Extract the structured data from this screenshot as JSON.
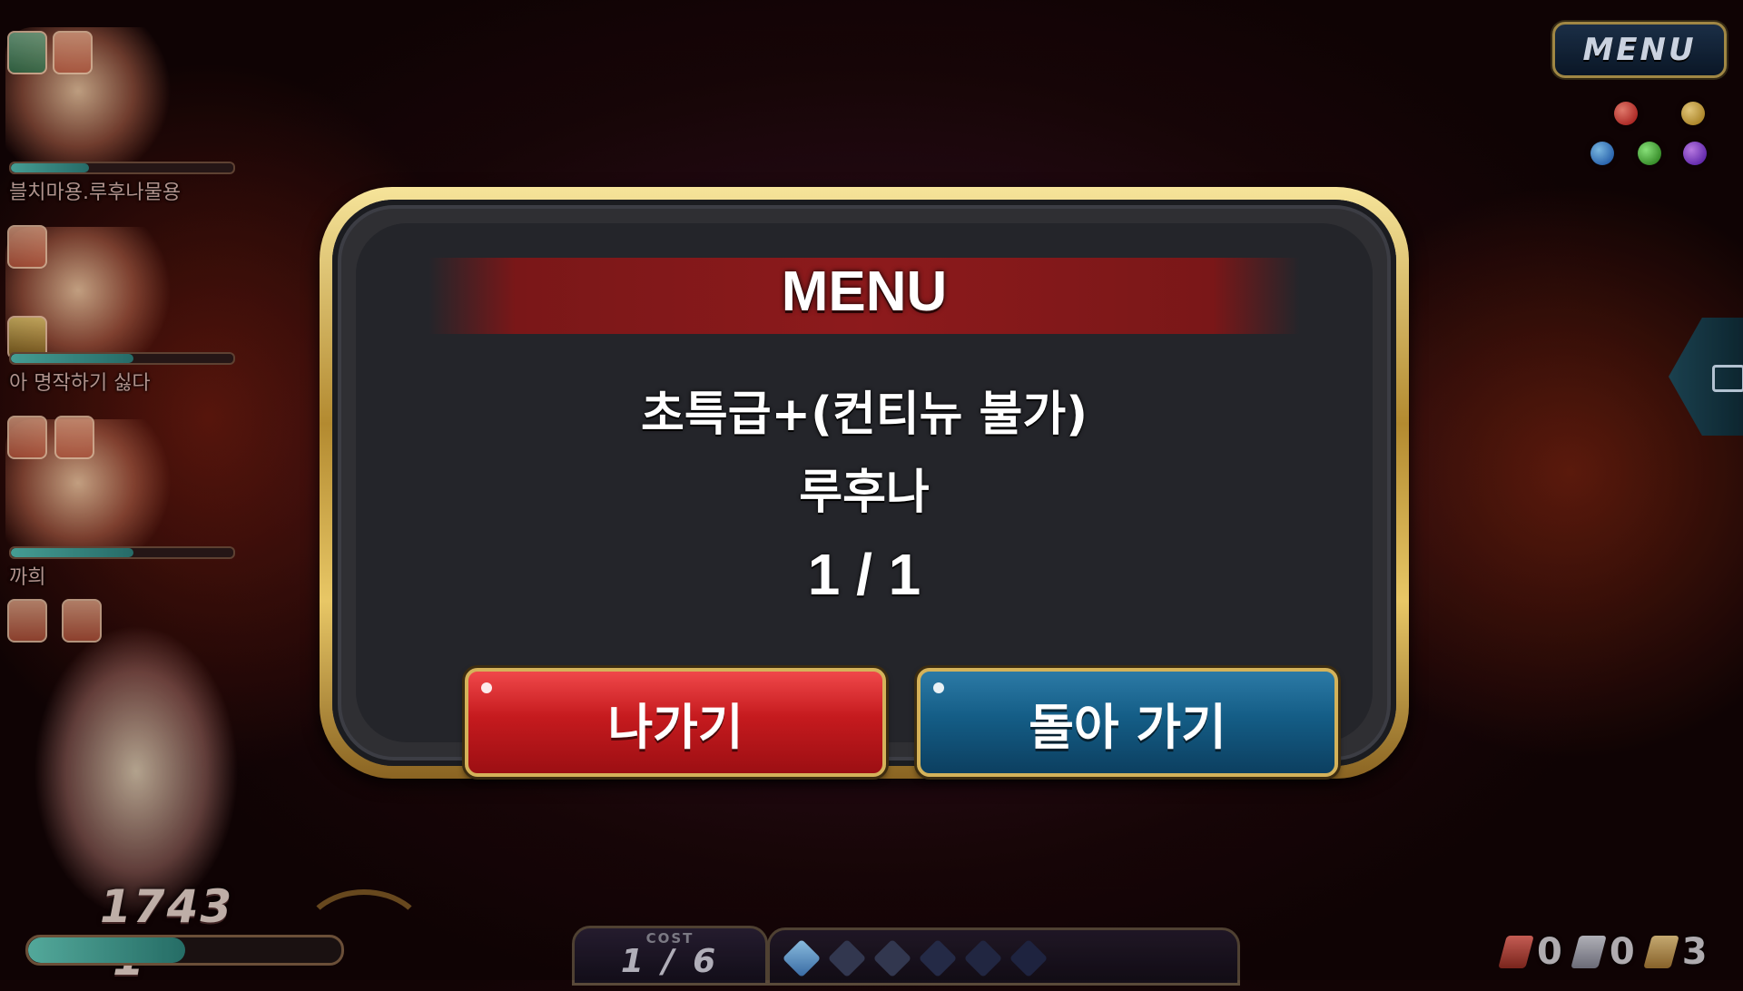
{
  "menu_button_label": "MENU",
  "party": [
    {
      "name": "블치마용.루후나물용",
      "hp_fraction": 0.35
    },
    {
      "name": "아 명작하기 싫다",
      "hp_fraction": 0.55
    },
    {
      "name": "까희",
      "hp_fraction": 0.55
    }
  ],
  "leader": {
    "score": "1743",
    "level": "1",
    "hp_fraction": 0.5
  },
  "cost": {
    "label": "COST",
    "value": "1 / 6"
  },
  "drops": [
    {
      "count": "0"
    },
    {
      "count": "0"
    },
    {
      "count": "3"
    }
  ],
  "dialog": {
    "title": "MENU",
    "quest_name": "초특급+(컨티뉴 불가)",
    "boss_name": "루후나",
    "wave": "1 / 1",
    "exit_label": "나가기",
    "back_label": "돌아 가기"
  },
  "colors": {
    "gold_frame": "#d4b25a",
    "title_band": "#8d1a1c",
    "exit_button": "#c51a1e",
    "back_button": "#145d86"
  },
  "icons": [
    "menu-button",
    "element-orbs",
    "chat-tab-icon",
    "crystal-gem-icon",
    "drop-card-icon"
  ]
}
